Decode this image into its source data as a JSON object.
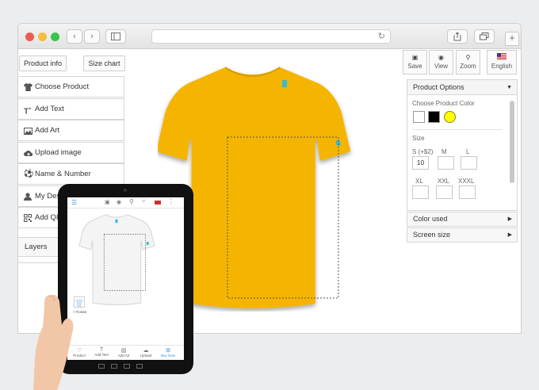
{
  "browser": {
    "traffic_lights": [
      "#ee5b54",
      "#f6bd3b",
      "#35c64a"
    ]
  },
  "left_panel": {
    "product_info": "Product info",
    "size_chart": "Size chart",
    "tools": [
      {
        "label": "Choose Product",
        "icon": "tshirt-icon"
      },
      {
        "label": "Add Text",
        "icon": "text-icon"
      },
      {
        "label": "Add Art",
        "icon": "image-icon"
      },
      {
        "label": "Upload image",
        "icon": "cloud-upload-icon"
      },
      {
        "label": "Name & Number",
        "icon": "ball-icon"
      },
      {
        "label": "My Des",
        "icon": "user-icon"
      },
      {
        "label": "Add QI",
        "icon": "qr-icon"
      }
    ],
    "layers": "Layers"
  },
  "toolbar": {
    "save": "Save",
    "view": "View",
    "zoom": "Zoom",
    "language": "English"
  },
  "product_options": {
    "title": "Product Options",
    "color_label": "Choose Product Color",
    "colors": [
      "#ffffff",
      "#000000",
      "#ffff00"
    ],
    "size_label": "Size",
    "sizes": [
      {
        "label": "S (+$2)",
        "value": "10"
      },
      {
        "label": "M",
        "value": ""
      },
      {
        "label": "L",
        "value": ""
      },
      {
        "label": "XL",
        "value": ""
      },
      {
        "label": "XXL",
        "value": ""
      },
      {
        "label": "XXXL",
        "value": ""
      }
    ],
    "color_used": "Color used",
    "screen_size": "Screen size"
  },
  "shirt": {
    "color": "#f5b400"
  },
  "tablet": {
    "rotate_label": "Rotate",
    "nav": [
      "Product",
      "Add Text",
      "Add Art",
      "Upload",
      "Buy Now"
    ]
  }
}
